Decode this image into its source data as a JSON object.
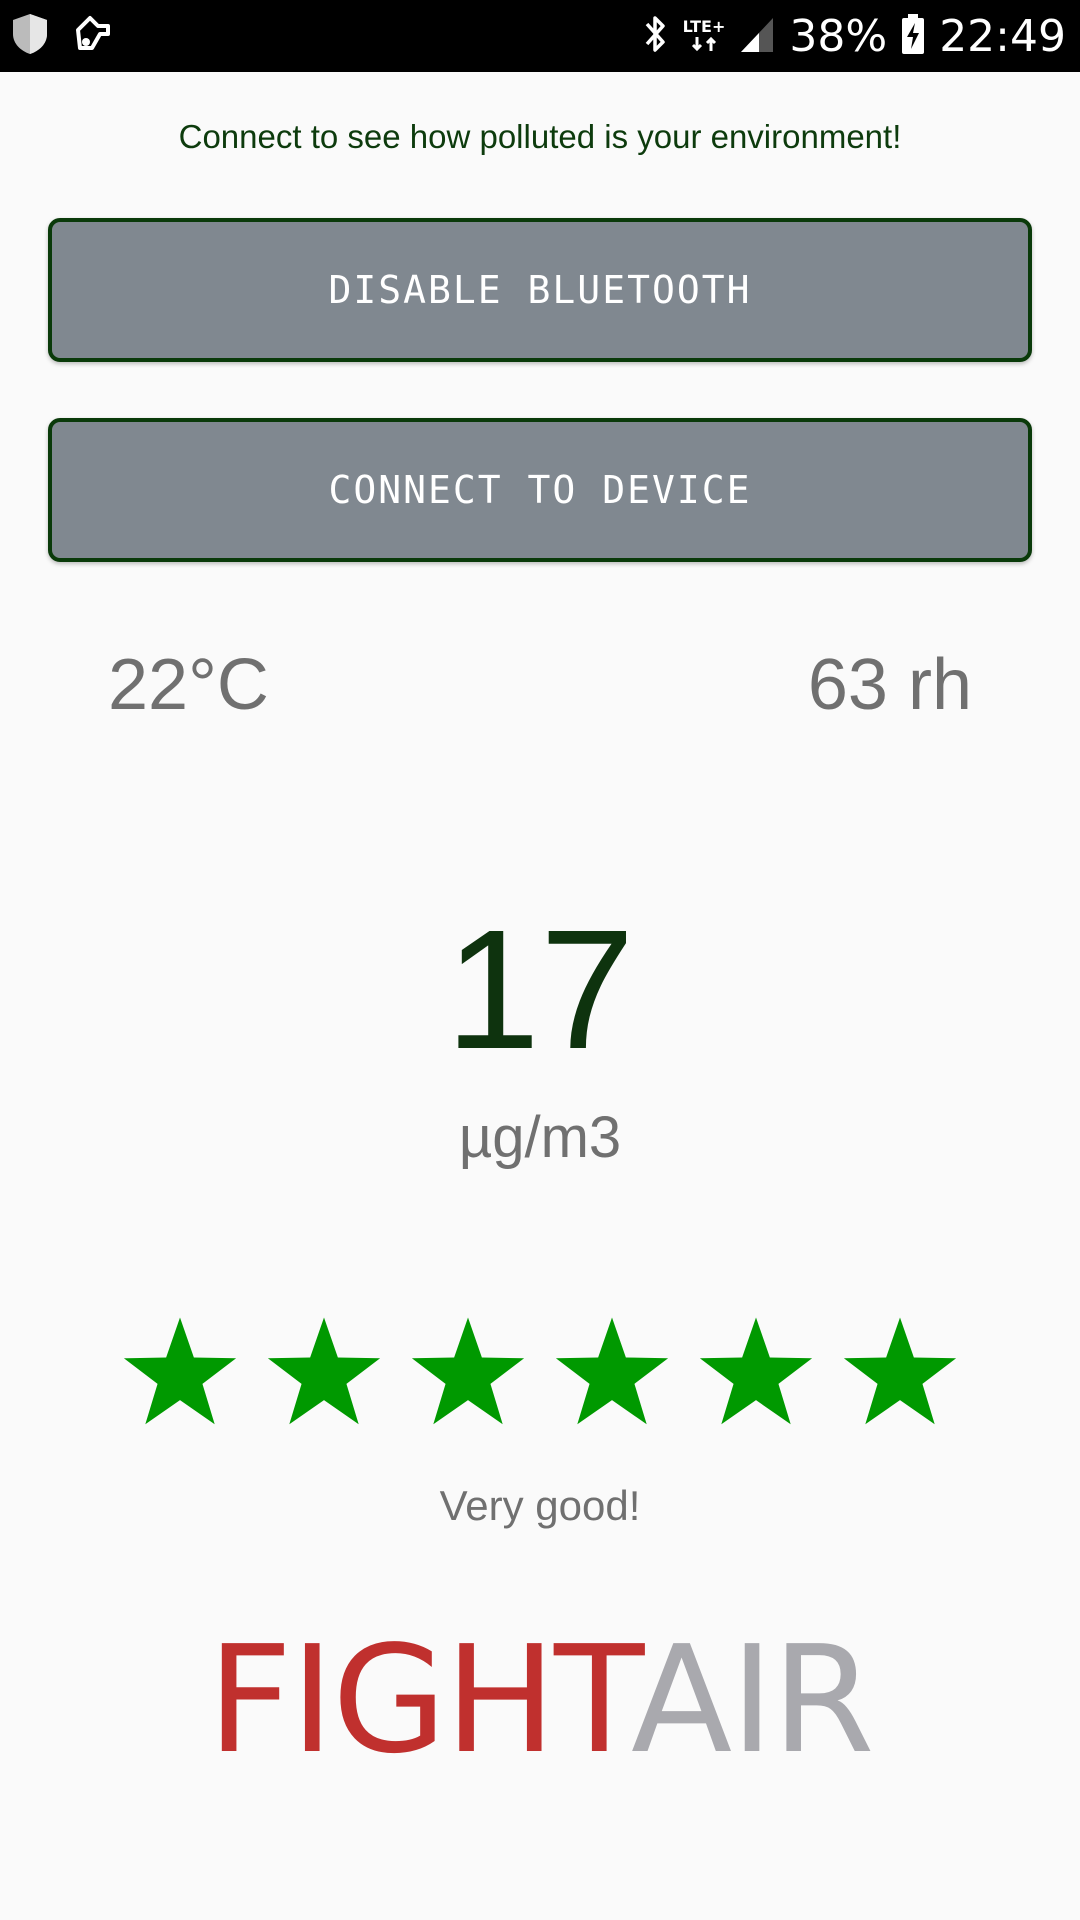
{
  "status_bar": {
    "icons_left": [
      "shield-icon",
      "usb-debug-icon"
    ],
    "icons_right": [
      "bluetooth-icon",
      "lte-plus-icon",
      "signal-icon",
      "battery-charging-icon"
    ],
    "network_label": "LTE+",
    "battery_percent": "38%",
    "time": "22:49"
  },
  "header": {
    "message": "Connect to see how polluted is your environment!"
  },
  "buttons": {
    "bluetooth_label": "DISABLE BLUETOOTH",
    "connect_label": "CONNECT TO DEVICE"
  },
  "readings": {
    "temperature": "22°C",
    "humidity": "63 rh",
    "pm_value": "17",
    "pm_unit": "µg/m3"
  },
  "rating": {
    "stars_filled": 6,
    "stars_total": 6,
    "star_color": "#009900",
    "label": "Very good!"
  },
  "logo": {
    "part1": "FIGHT",
    "part2": "AIR",
    "part1_color": "#c0302e",
    "part2_color": "#a9a9ae"
  },
  "colors": {
    "button_bg": "#808890",
    "button_border": "#0a3a0a",
    "background": "#fafafa"
  }
}
